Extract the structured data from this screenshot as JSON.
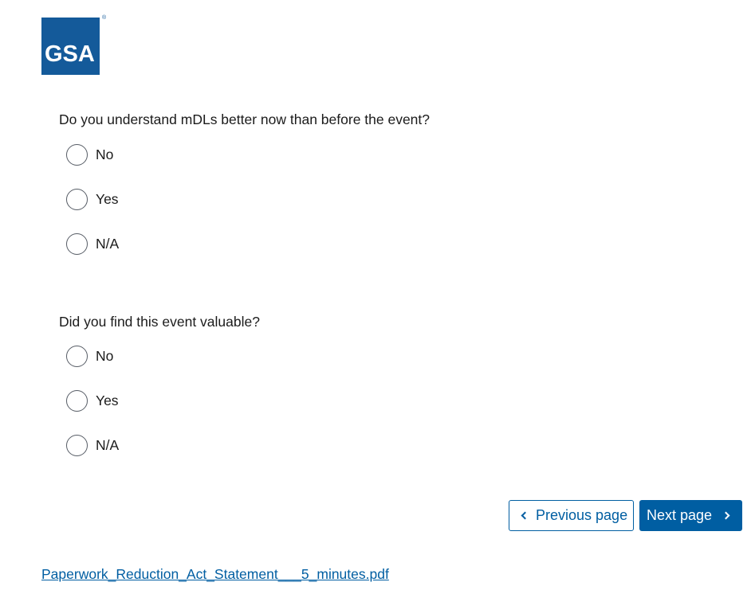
{
  "logo": {
    "text": "GSA",
    "registered_mark": "®",
    "color": "#145a9a"
  },
  "questions": [
    {
      "text": "Do you understand mDLs better now than before the event?",
      "options": [
        "No",
        "Yes",
        "N/A"
      ],
      "selected": null
    },
    {
      "text": "Did you find this event valuable?",
      "options": [
        "No",
        "Yes",
        "N/A"
      ],
      "selected": null
    }
  ],
  "navigation": {
    "previous_label": "Previous page",
    "next_label": "Next page",
    "previous_icon": "chevron-left-icon",
    "next_icon": "chevron-right-icon"
  },
  "footer": {
    "link_text": "Paperwork_Reduction_Act_Statement___5_minutes.pdf"
  },
  "colors": {
    "primary": "#005ea2",
    "text": "#1b1b1b",
    "radio_border": "#565c65"
  }
}
